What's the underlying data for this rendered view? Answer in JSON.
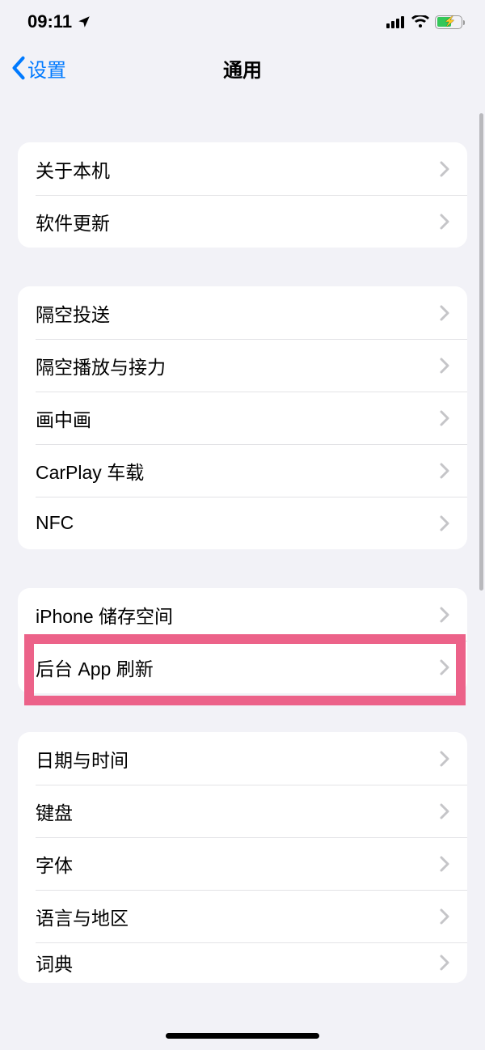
{
  "status": {
    "time": "09:11"
  },
  "nav": {
    "back": "设置",
    "title": "通用"
  },
  "groups": [
    {
      "rows": [
        "关于本机",
        "软件更新"
      ]
    },
    {
      "rows": [
        "隔空投送",
        "隔空播放与接力",
        "画中画",
        "CarPlay 车载",
        "NFC"
      ]
    },
    {
      "rows": [
        "iPhone 储存空间",
        "后台 App 刷新"
      ]
    },
    {
      "rows": [
        "日期与时间",
        "键盘",
        "字体",
        "语言与地区",
        "词典"
      ]
    }
  ],
  "highlightRow": "后台 App 刷新"
}
